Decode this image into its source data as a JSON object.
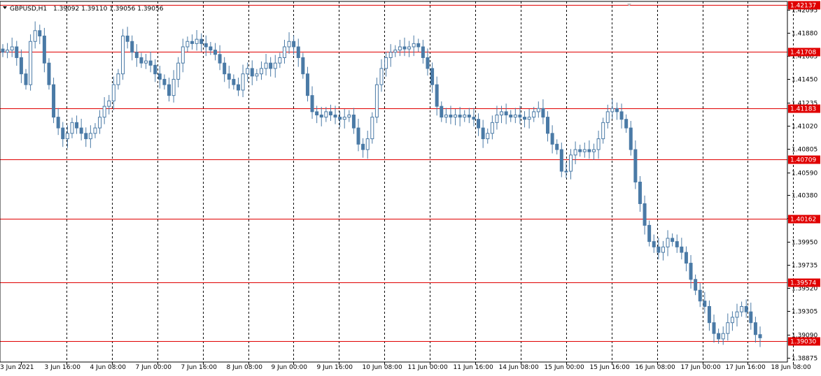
{
  "chart_header": {
    "symbol_tf": "GBPUSD,H1",
    "ohlc": "1.39092 1.39110 1.39056 1.39056"
  },
  "chart_data": {
    "type": "candlestick",
    "title": "GBPUSD,H1",
    "ylim": [
      1.38875,
      1.4217
    ],
    "y_ticks": [
      "1.42095",
      "1.41880",
      "1.41665",
      "1.41450",
      "1.41235",
      "1.41020",
      "1.40805",
      "1.40590",
      "1.40380",
      "1.40165",
      "1.39950",
      "1.39735",
      "1.39520",
      "1.39305",
      "1.39090",
      "1.38875"
    ],
    "x_ticks": [
      "3 Jun 2021",
      "3 Jun 16:00",
      "4 Jun 08:00",
      "7 Jun 00:00",
      "7 Jun 16:00",
      "8 Jun 08:00",
      "9 Jun 00:00",
      "9 Jun 16:00",
      "10 Jun 08:00",
      "11 Jun 00:00",
      "11 Jun 16:00",
      "14 Jun 08:00",
      "15 Jun 00:00",
      "15 Jun 16:00",
      "16 Jun 08:00",
      "17 Jun 00:00",
      "17 Jun 16:00",
      "18 Jun 08:00"
    ],
    "levels": [
      {
        "value": 1.42137,
        "label": "1.42137"
      },
      {
        "value": 1.41708,
        "label": "1.41708"
      },
      {
        "value": 1.41183,
        "label": "1.41183"
      },
      {
        "value": 1.40709,
        "label": "1.40709"
      },
      {
        "value": 1.40162,
        "label": "1.40162"
      },
      {
        "value": 1.39574,
        "label": "1.39574"
      },
      {
        "value": 1.3903,
        "label": "1.39030"
      }
    ],
    "series": [
      {
        "values": [
          1.417,
          1.4172,
          1.4175,
          1.4165,
          1.415,
          1.414,
          1.418,
          1.419,
          1.4185,
          1.416,
          1.414,
          1.411,
          1.41,
          1.409,
          1.4095,
          1.4105,
          1.41,
          1.4095,
          1.409,
          1.4095,
          1.41,
          1.411,
          1.412,
          1.4125,
          1.414,
          1.415,
          1.4185,
          1.418,
          1.417,
          1.4165,
          1.416,
          1.4162,
          1.4158,
          1.415,
          1.4145,
          1.414,
          1.413,
          1.4145,
          1.416,
          1.4175,
          1.418,
          1.4178,
          1.4182,
          1.4178,
          1.4175,
          1.4172,
          1.4168,
          1.416,
          1.415,
          1.4145,
          1.414,
          1.4135,
          1.415,
          1.4155,
          1.4148,
          1.415,
          1.4155,
          1.416,
          1.4155,
          1.416,
          1.4165,
          1.4175,
          1.418,
          1.4175,
          1.4165,
          1.415,
          1.413,
          1.4115,
          1.4112,
          1.411,
          1.4115,
          1.4112,
          1.411,
          1.4108,
          1.411,
          1.4112,
          1.41,
          1.4085,
          1.408,
          1.409,
          1.411,
          1.414,
          1.4155,
          1.4165,
          1.417,
          1.4172,
          1.4175,
          1.4173,
          1.4175,
          1.4178,
          1.4175,
          1.4165,
          1.4155,
          1.414,
          1.412,
          1.411,
          1.4112,
          1.411,
          1.4112,
          1.411,
          1.4112,
          1.411,
          1.4108,
          1.41,
          1.409,
          1.4095,
          1.4105,
          1.4112,
          1.4115,
          1.4112,
          1.411,
          1.4112,
          1.411,
          1.4108,
          1.411,
          1.4115,
          1.4118,
          1.411,
          1.4095,
          1.4085,
          1.408,
          1.406,
          1.406,
          1.4075,
          1.408,
          1.4078,
          1.408,
          1.4078,
          1.408,
          1.409,
          1.4105,
          1.4115,
          1.4118,
          1.4115,
          1.4108,
          1.41,
          1.408,
          1.405,
          1.403,
          1.401,
          1.3995,
          1.399,
          1.3985,
          1.399,
          1.3998,
          1.3995,
          1.399,
          1.3985,
          1.3975,
          1.396,
          1.395,
          1.394,
          1.3935,
          1.392,
          1.391,
          1.3905,
          1.391,
          1.392,
          1.3925,
          1.393,
          1.3935,
          1.393,
          1.392,
          1.3909,
          1.3906
        ]
      }
    ]
  }
}
